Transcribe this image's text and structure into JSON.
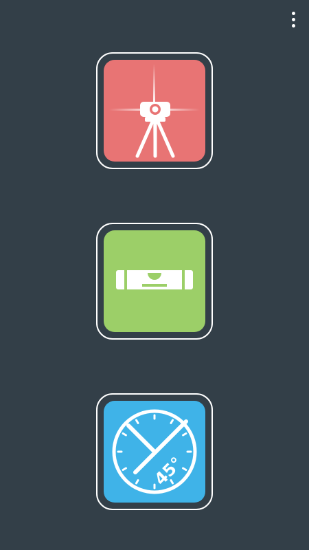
{
  "app": {
    "tools": [
      {
        "id": "laser-level",
        "icon": "laser-level-tripod-icon",
        "color": "#e87474"
      },
      {
        "id": "bubble-level",
        "icon": "spirit-level-icon",
        "color": "#9ccf68"
      },
      {
        "id": "angle-meter",
        "icon": "protractor-45-degree-icon",
        "color": "#3fb3e8",
        "icon_text": "45°"
      }
    ]
  },
  "toolbar": {
    "menu_icon": "overflow-menu-icon"
  },
  "colors": {
    "background": "#333f48",
    "tile_border": "#ffffff",
    "icon_foreground": "#ffffff"
  }
}
